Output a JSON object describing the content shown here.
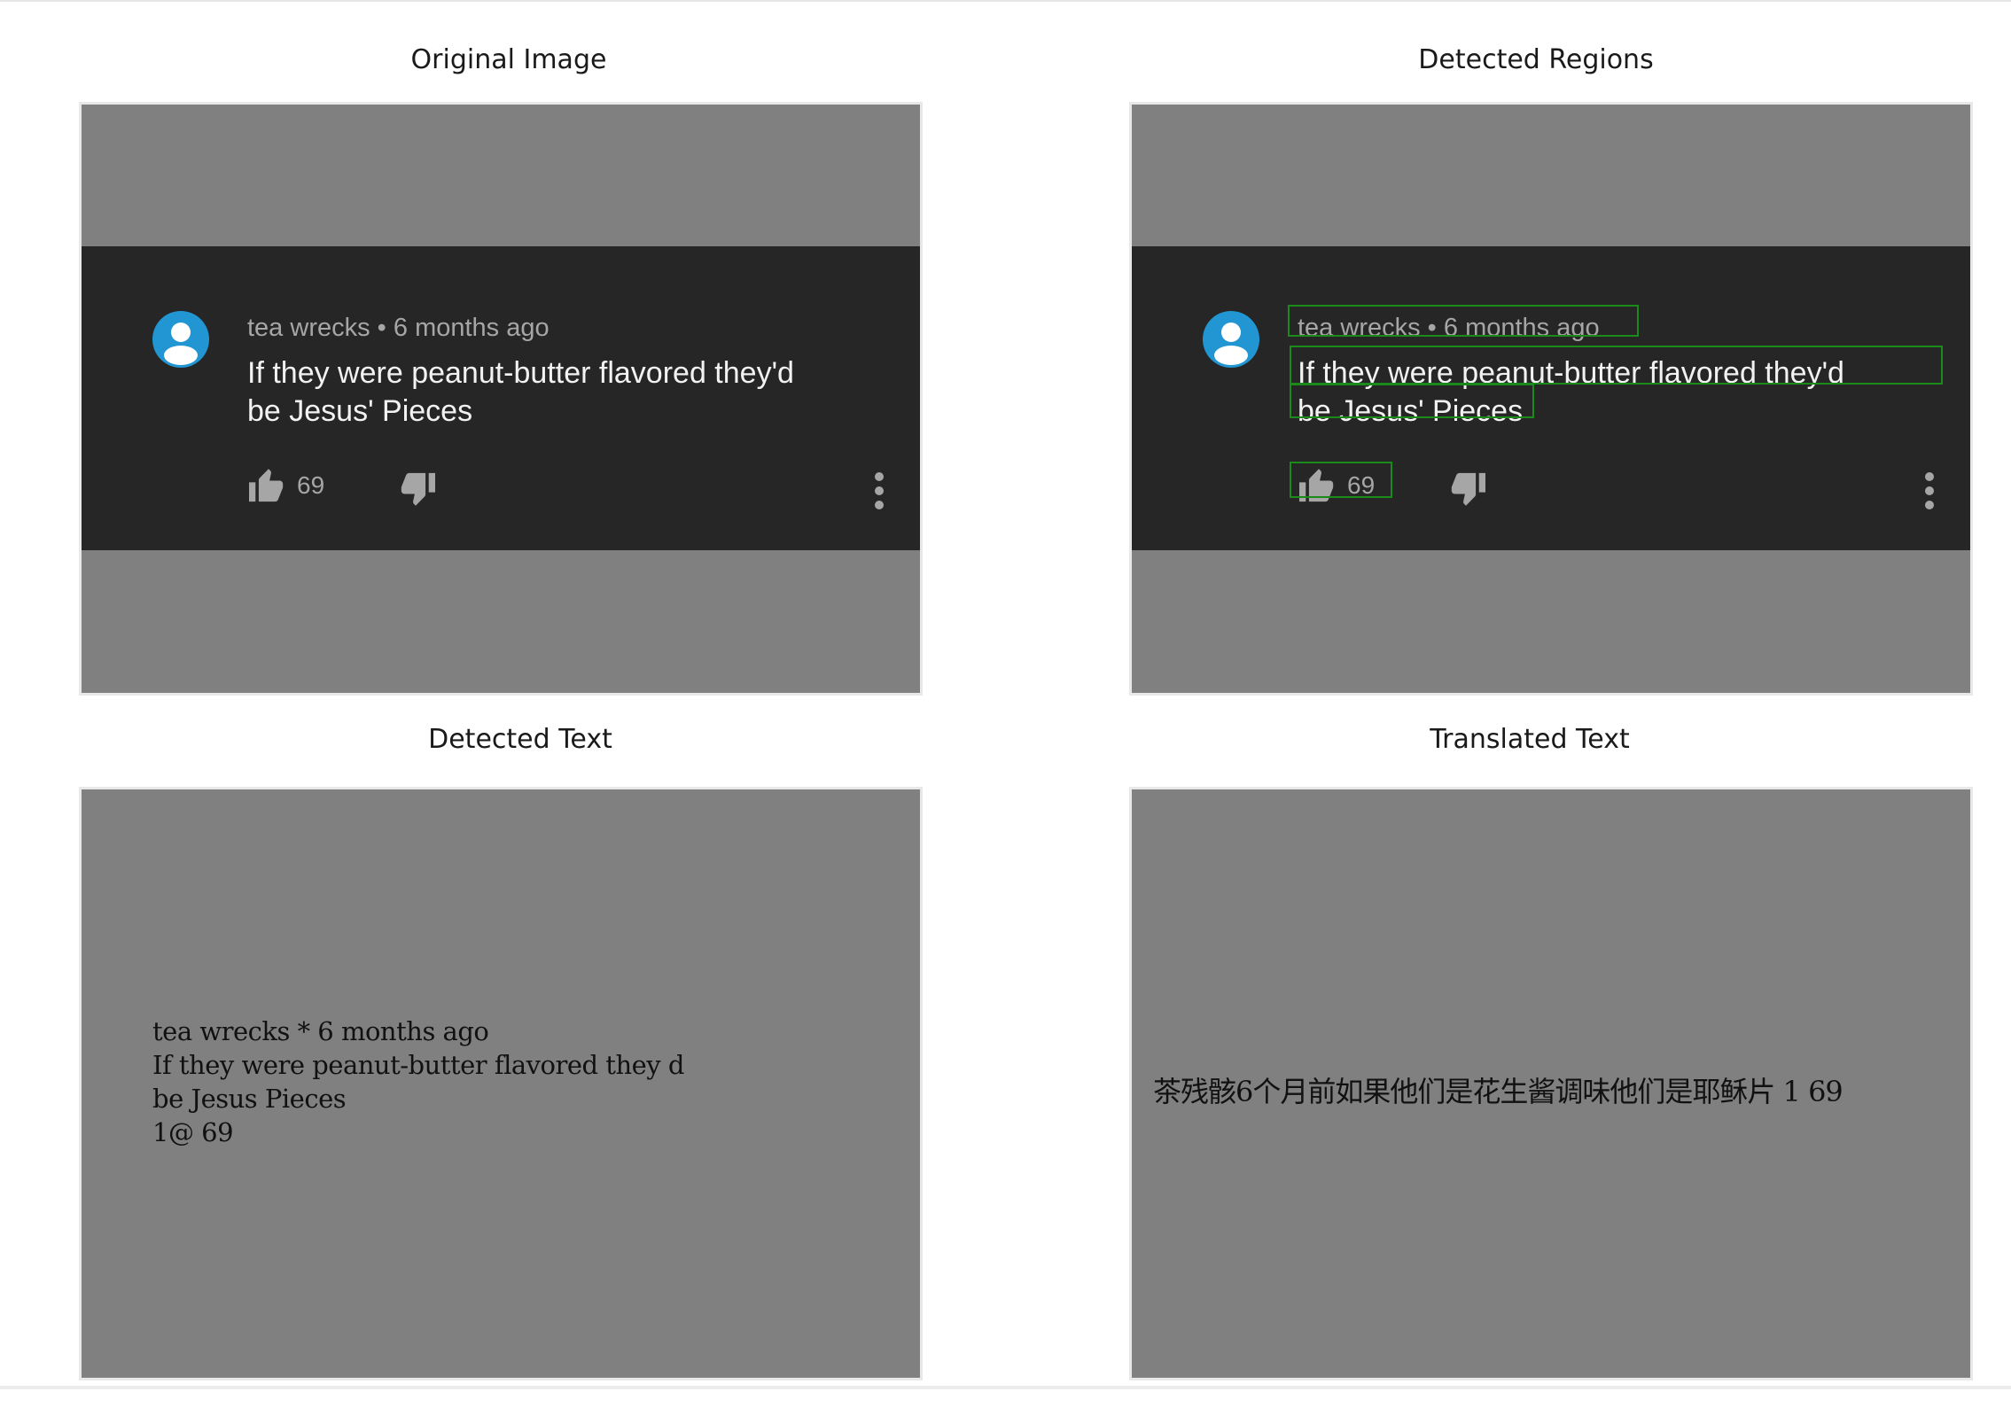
{
  "panels": {
    "original": {
      "title": "Original Image"
    },
    "detected_regions": {
      "title": "Detected Regions"
    },
    "detected_text": {
      "title": "Detected Text"
    },
    "translated_text": {
      "title": "Translated Text"
    }
  },
  "comment": {
    "author": "tea wrecks",
    "separator": "•",
    "time_ago": "6 months ago",
    "line_1": "If they were peanut-butter flavored they'd",
    "line_2": "be Jesus' Pieces",
    "like_count": "69"
  },
  "ocr": {
    "line_1": "tea wrecks * 6 months ago",
    "line_2": "If they were peanut-butter flavored they d",
    "line_3": "be Jesus Pieces",
    "line_4": "1@ 69"
  },
  "translation": {
    "text": "茶残骸6个月前如果他们是花生酱调味他们是耶稣片 1 69"
  },
  "colors": {
    "frame_bg": "#808080",
    "card_bg": "#262626",
    "avatar": "#2196d3",
    "detection_box": "#1a8a1a"
  },
  "icons": {
    "avatar": "user-avatar-icon",
    "like": "thumbs-up-icon",
    "dislike": "thumbs-down-icon",
    "more": "more-vertical-icon"
  }
}
